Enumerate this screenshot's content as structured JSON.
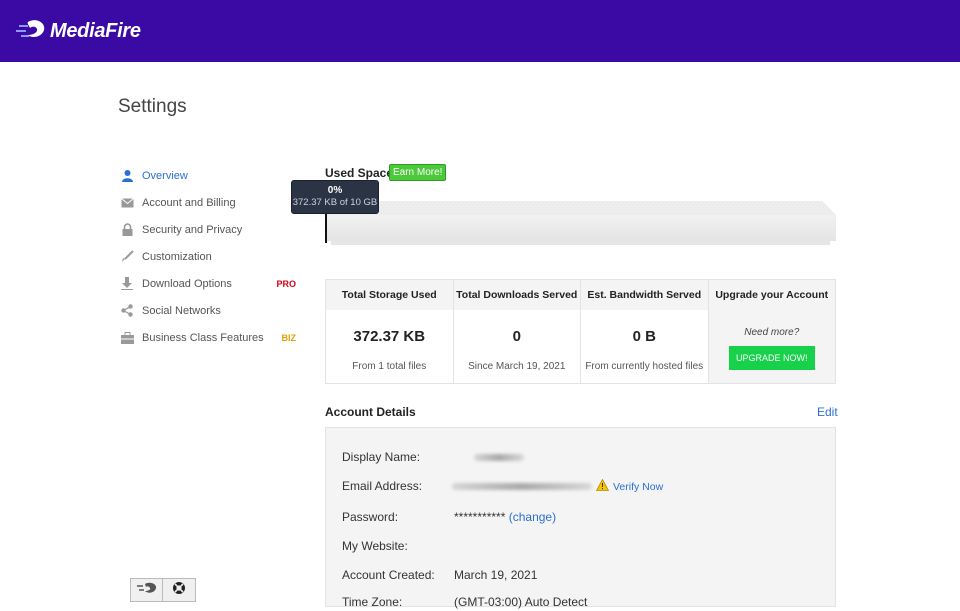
{
  "header": {
    "logo_text": "MediaFire",
    "logo_icon": "mediafire-flame-icon",
    "brand_color": "#3b0aa5"
  },
  "page": {
    "title": "Settings"
  },
  "sidebar": {
    "items": [
      {
        "label": "Overview",
        "icon": "user-icon",
        "active": true
      },
      {
        "label": "Account and Billing",
        "icon": "envelope-icon"
      },
      {
        "label": "Security and Privacy",
        "icon": "lock-icon"
      },
      {
        "label": "Customization",
        "icon": "brush-icon"
      },
      {
        "label": "Download Options",
        "icon": "download-icon",
        "badge": "PRO"
      },
      {
        "label": "Social Networks",
        "icon": "share-icon"
      },
      {
        "label": "Business Class Features",
        "icon": "briefcase-icon",
        "badge": "BIZ"
      }
    ]
  },
  "used_space": {
    "label": "Used Space",
    "earn_more": "Earn More!",
    "percent_label": "0%",
    "amount_label": "372.37 KB of 10 GB",
    "fraction": 0.0
  },
  "stats": {
    "total_storage": {
      "header": "Total Storage Used",
      "value": "372.37 KB",
      "sub": "From 1 total files"
    },
    "total_downloads": {
      "header": "Total Downloads Served",
      "value": "0",
      "sub": "Since March 19, 2021"
    },
    "bandwidth": {
      "header": "Est. Bandwidth Served",
      "value": "0 B",
      "sub": "From currently hosted files"
    },
    "upgrade": {
      "header": "Upgrade your Account",
      "need_more": "Need more?",
      "button": "UPGRADE NOW!"
    }
  },
  "account_details": {
    "title": "Account Details",
    "edit": "Edit",
    "rows": {
      "display_name": {
        "label": "Display Name:"
      },
      "email": {
        "label": "Email Address:",
        "verify": "Verify Now"
      },
      "password": {
        "label": "Password:",
        "value": "***********",
        "change": "(change)"
      },
      "website": {
        "label": "My Website:"
      },
      "created": {
        "label": "Account Created:",
        "value": "March 19, 2021"
      },
      "timezone": {
        "label": "Time Zone:",
        "value": "(GMT-03:00) Auto Detect"
      }
    }
  },
  "footer": {
    "buttons": [
      {
        "icon": "mediafire-flame-icon"
      },
      {
        "icon": "help-lifebuoy-icon"
      }
    ]
  }
}
